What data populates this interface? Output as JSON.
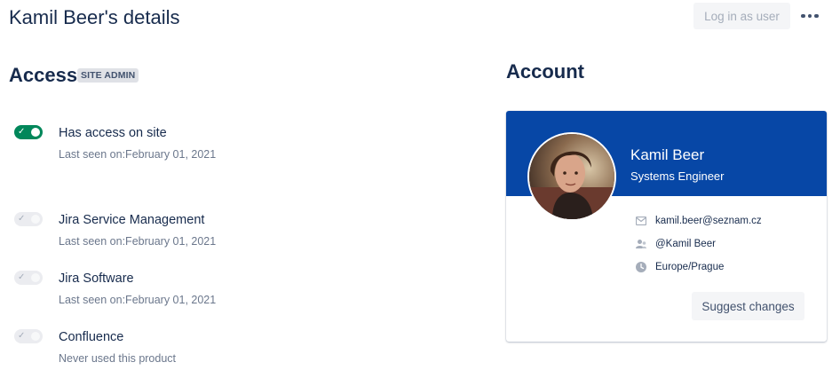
{
  "page": {
    "title": "Kamil Beer's details",
    "login_as_user": "Log in as user",
    "more_actions_icon": "more-horizontal-icon"
  },
  "access": {
    "heading": "Access",
    "badge": "SITE ADMIN",
    "products": [
      {
        "name": "Has access on site",
        "status": "Last seen on:February 01, 2021",
        "enabled": true
      },
      {
        "name": "Jira Service Management",
        "status": "Last seen on:February 01, 2021",
        "enabled": false
      },
      {
        "name": "Jira Software",
        "status": "Last seen on:February 01, 2021",
        "enabled": false
      },
      {
        "name": "Confluence",
        "status": "Never used this product",
        "enabled": false
      }
    ]
  },
  "account": {
    "heading": "Account",
    "name": "Kamil Beer",
    "job_title": "Systems Engineer",
    "email": "kamil.beer@seznam.cz",
    "username": "@Kamil Beer",
    "timezone": "Europe/Prague",
    "suggest_changes": "Suggest changes"
  },
  "colors": {
    "header_blue": "#0747a6",
    "toggle_on": "#00875a",
    "text_primary": "#172b4d",
    "text_subtle": "#6b778c"
  }
}
